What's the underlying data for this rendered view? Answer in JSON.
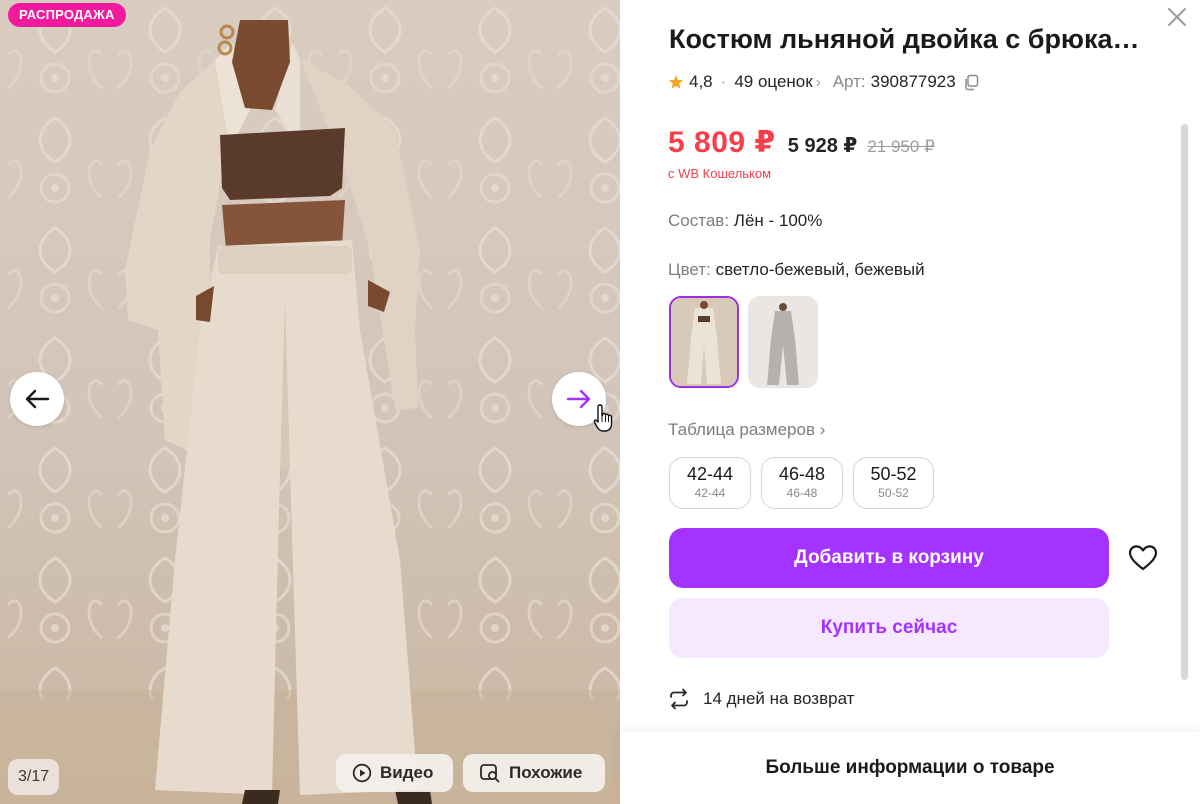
{
  "gallery": {
    "sale_badge": "РАСПРОДАЖА",
    "counter": "3/17",
    "video_label": "Видео",
    "similar_label": "Похожие"
  },
  "product": {
    "title": "Костюм льняной двойка с брюка…",
    "rating": "4,8",
    "reviews": "49 оценок",
    "article_label": "Арт:",
    "article": "390877923",
    "price_main": "5 809 ₽",
    "price_mid": "5 928 ₽",
    "price_old": "21 950 ₽",
    "wallet_note": "с WB Кошельком",
    "composition_label": "Состав:",
    "composition": "Лён - 100%",
    "color_label": "Цвет:",
    "color": "светло-бежевый, бежевый",
    "size_table_label": "Таблица размеров",
    "sizes": [
      {
        "main": "42-44",
        "sub": "42-44"
      },
      {
        "main": "46-48",
        "sub": "46-48"
      },
      {
        "main": "50-52",
        "sub": "50-52"
      }
    ],
    "add_to_cart": "Добавить в корзину",
    "buy_now": "Купить сейчас",
    "returns": "14 дней на возврат",
    "more_info": "Больше информации о товаре"
  },
  "colors": {
    "accent": "#a533ff",
    "accent_light": "#f5e8ff",
    "price_red": "#f53f4a",
    "sale_pink": "#f11a9d",
    "star": "#f5a623"
  }
}
